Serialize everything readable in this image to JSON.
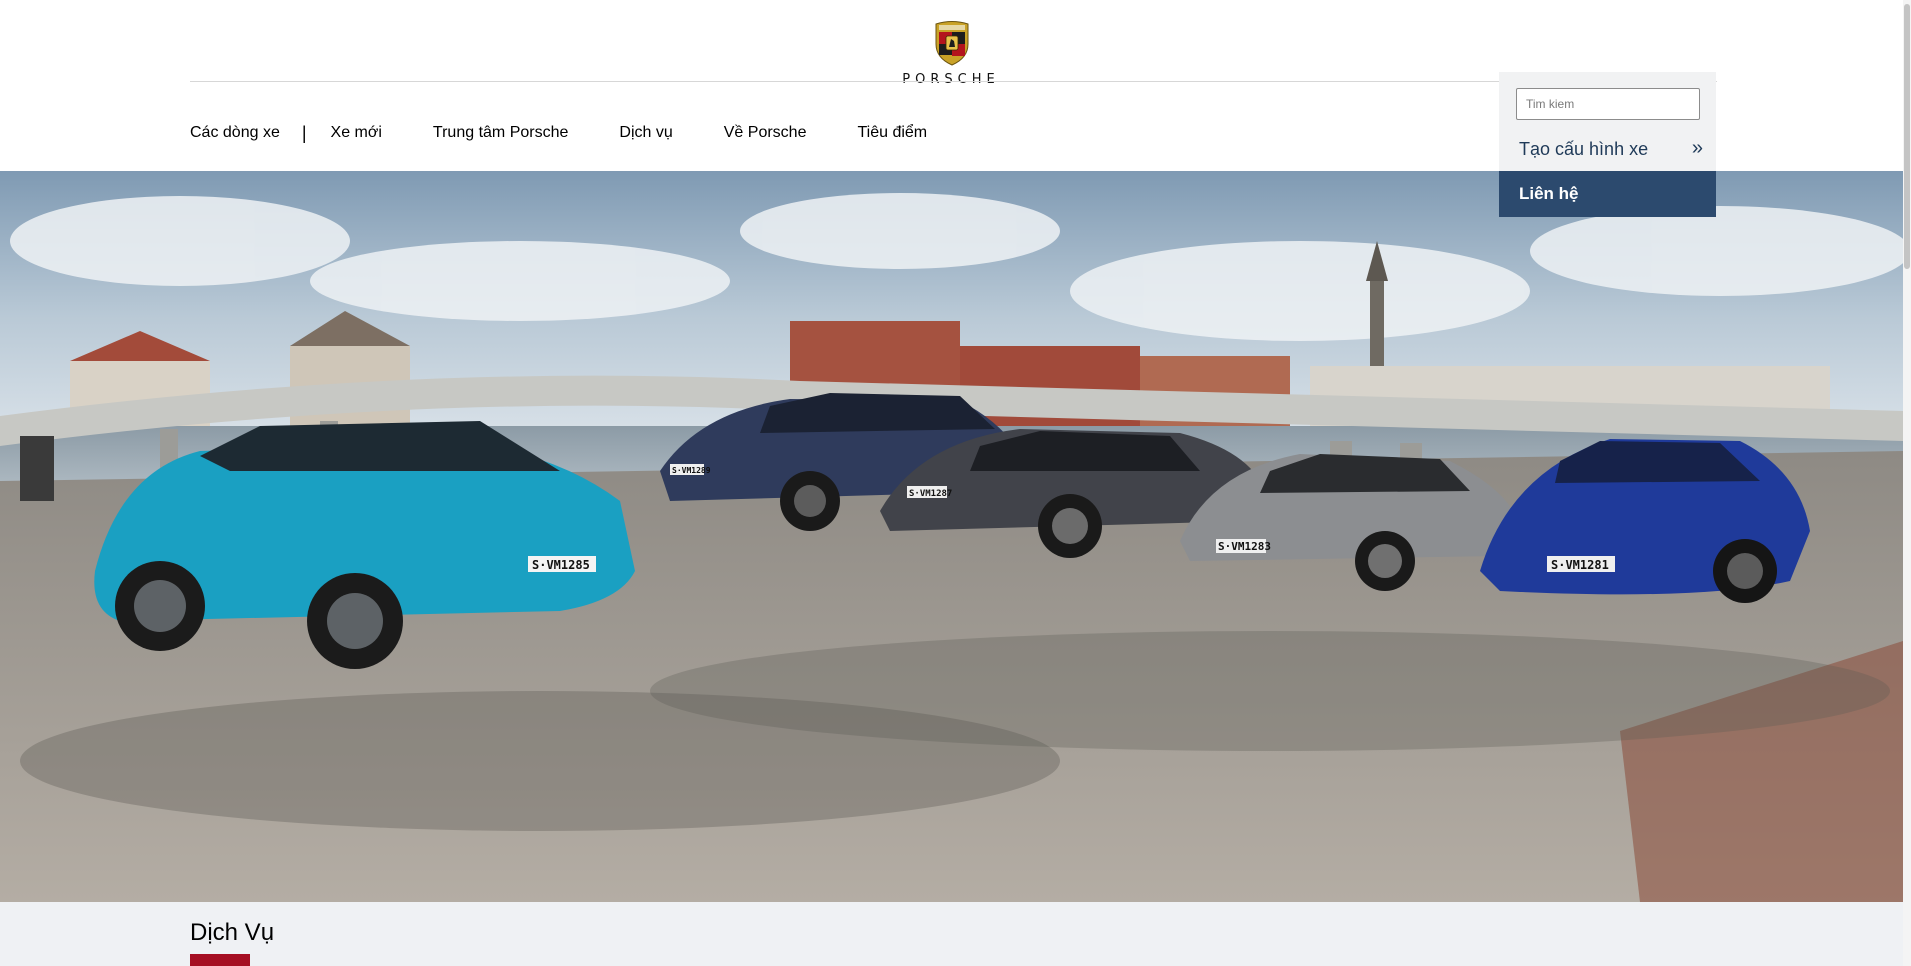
{
  "brand": {
    "wordmark": "PORSCHE",
    "logo_icon": "porsche-crest-icon"
  },
  "nav": {
    "items": [
      {
        "label": "Các dòng xe"
      },
      {
        "label": "Xe mới"
      },
      {
        "label": "Trung tâm Porsche"
      },
      {
        "label": "Dịch vụ"
      },
      {
        "label": "Về Porsche"
      },
      {
        "label": "Tiêu điểm"
      }
    ],
    "separator": "|"
  },
  "panel": {
    "search_placeholder": "Tim kiem",
    "configurator_label": "Tạo cấu hình xe",
    "configurator_arrow": "»",
    "contact_label": "Liên hệ"
  },
  "hero": {
    "plates": [
      "S·VM1285",
      "S·VM1289",
      "S·VM1287",
      "S·VM1283",
      "S·VM1281"
    ]
  },
  "section": {
    "title": "Dịch Vụ"
  },
  "colors": {
    "accent_red": "#a50f23",
    "navy": "#2c4a6e",
    "panel_bg": "#f1f2f3",
    "section_bg": "#eff1f4"
  }
}
